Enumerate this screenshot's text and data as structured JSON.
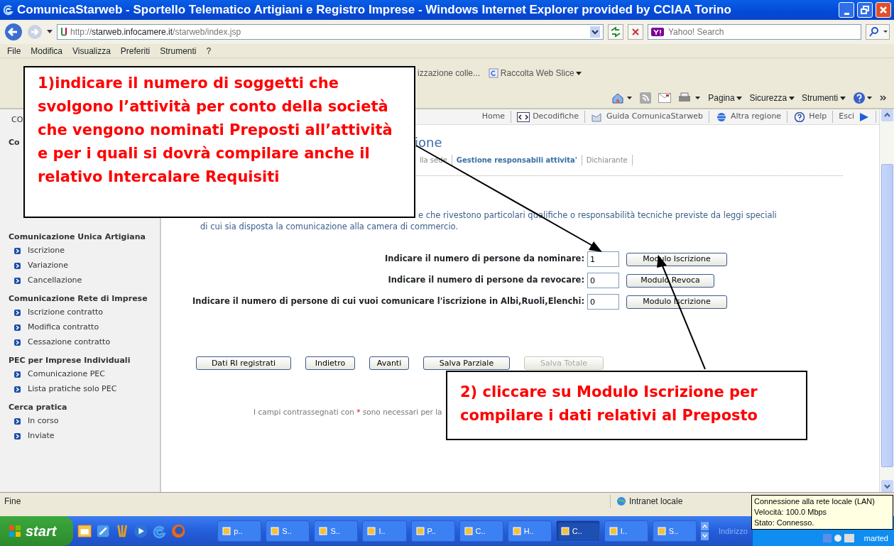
{
  "window": {
    "title": "ComunicaStarweb - Sportello Telematico Artigiani e Registro Imprese - Windows Internet Explorer provided by CCIAA Torino"
  },
  "address_bar": {
    "url_scheme": "http://",
    "url_host": "starweb.infocamere.it",
    "url_path": "/starweb/index.jsp",
    "search_placeholder": "Yahoo! Search"
  },
  "menu": [
    "File",
    "Modifica",
    "Visualizza",
    "Preferiti",
    "Strumenti",
    "?"
  ],
  "favorites_bar": [
    "izzazione colle...",
    "Raccolta Web Slice"
  ],
  "command_bar": [
    "Pagina",
    "Sicurezza",
    "Strumenti"
  ],
  "site_toolbar": [
    {
      "kind": "plain",
      "label": "Home"
    },
    {
      "kind": "code",
      "label": "Decodifiche"
    },
    {
      "kind": "guide",
      "label": "Guida ComunicaStarweb"
    },
    {
      "kind": "region",
      "label": "Altra regione"
    },
    {
      "kind": "help",
      "label": "Help"
    },
    {
      "kind": "exit",
      "label": "Esci"
    }
  ],
  "sidebar": {
    "fragment": "CO",
    "sections": [
      {
        "heading": "Co"
      },
      {
        "heading": "Comunicazione Unica Artigiana",
        "items": [
          "Iscrizione",
          "Variazione",
          "Cancellazione"
        ]
      },
      {
        "heading": "Comunicazione Rete di Imprese",
        "items": [
          "Iscrizione contratto",
          "Modifica contratto",
          "Cessazione contratto"
        ]
      },
      {
        "heading": "PEC per Imprese Individuali",
        "items": [
          "Comunicazione PEC",
          "Lista pratiche solo PEC"
        ]
      },
      {
        "heading": "Cerca pratica",
        "items": [
          "In corso",
          "Inviate"
        ]
      }
    ]
  },
  "page": {
    "title_fragment": "ione",
    "breadcrumb": [
      {
        "label": "lla sede",
        "selected": false
      },
      {
        "label": "Gestione responsabili attivita'",
        "selected": true
      },
      {
        "label": "Dichiarante",
        "selected": false
      }
    ],
    "description": [
      "e che rivestono particolari qualifiche o responsabilità tecniche previste da leggi speciali",
      "di cui sia disposta la comunicazione alla camera di commercio."
    ],
    "form_rows": [
      {
        "label": "Indicare il numero di persone da nominare:",
        "value": "1",
        "button": "Modulo Iscrizione"
      },
      {
        "label": "Indicare il numero di persone da revocare:",
        "value": "0",
        "button": "Modulo Revoca"
      },
      {
        "label": "Indicare il numero di persone di cui vuoi comunicare l'iscrizione in Albi,Ruoli,Elenchi:",
        "value": "0",
        "button": "Modulo Iscrizione"
      }
    ],
    "actions": [
      {
        "label": "Dati RI registrati",
        "disabled": false
      },
      {
        "label": "Indietro",
        "disabled": false
      },
      {
        "label": "Avanti",
        "disabled": false
      },
      {
        "label": "Salva Parziale",
        "disabled": false
      },
      {
        "label": "Salva Totale",
        "disabled": true
      }
    ],
    "note": {
      "before": "I campi contrassegnati con",
      "mark": "*",
      "after": "sono necessari per la"
    }
  },
  "callouts": [
    "1)indicare il numero di soggetti che svolgono l’attività per conto della società che vengono nominati Preposti all’attività e per i quali si dovrà compilare anche il relativo Intercalare Requisiti",
    "2) cliccare su Modulo Iscrizione per compilare i dati relativi al Preposto"
  ],
  "status_bar": {
    "text": "Fine",
    "zone": "Intranet locale"
  },
  "taskbar": {
    "start": "start",
    "tasks": [
      {
        "label": "p..",
        "selected": false
      },
      {
        "label": "S..",
        "selected": false
      },
      {
        "label": "S..",
        "selected": false
      },
      {
        "label": "I..",
        "selected": false
      },
      {
        "label": "P..",
        "selected": false
      },
      {
        "label": "C..",
        "selected": false
      },
      {
        "label": "H..",
        "selected": false
      },
      {
        "label": "C..",
        "selected": true
      },
      {
        "label": "I..",
        "selected": false
      },
      {
        "label": "S..",
        "selected": false
      }
    ],
    "address_label": "Indirizzo",
    "clock": "marted"
  },
  "tooltip": [
    "Connessione alla rete locale (LAN)",
    "Velocità: 100.0 Mbps",
    "Stato: Connesso."
  ]
}
